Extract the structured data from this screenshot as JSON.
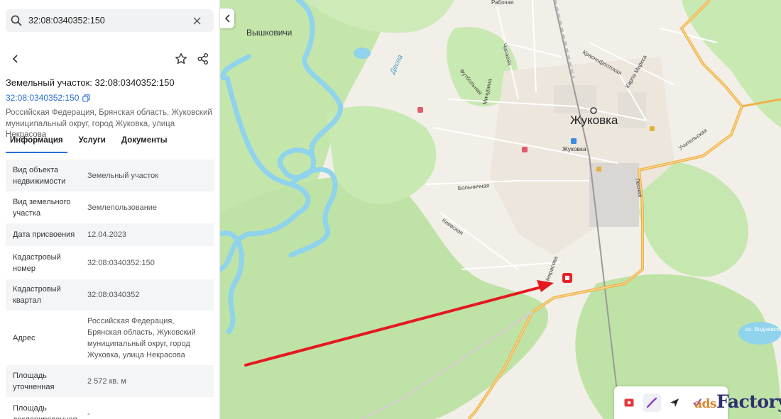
{
  "search": {
    "value": "32:08:0340352:150"
  },
  "card": {
    "title": "Земельный участок: 32:08:0340352:150",
    "cad_number_link": "32:08:0340352:150",
    "address": "Российская Федерация, Брянская область, Жуковский муниципальный округ, город Жуковка, улица Некрасова"
  },
  "tabs": [
    {
      "label": "Информация",
      "active": true
    },
    {
      "label": "Услуги"
    },
    {
      "label": "Документы"
    }
  ],
  "info_rows": [
    {
      "key": "Вид объекта недвижимости",
      "value": "Земельный участок"
    },
    {
      "key": "Вид земельного участка",
      "value": "Землепользование"
    },
    {
      "key": "Дата присвоения",
      "value": "12.04.2023"
    },
    {
      "key": "Кадастровый номер",
      "value": "32:08:0340352:150"
    },
    {
      "key": "Кадастровый квартал",
      "value": "32:08:0340352"
    },
    {
      "key": "Адрес",
      "value": "Российская Федерация, Брянская область, Жуковский муниципальный округ, город Жуковка, улица Некрасова"
    },
    {
      "key": "Площадь уточненная",
      "value": "2 572 кв. м"
    },
    {
      "key": "Площадь декларированная",
      "value": "-"
    }
  ],
  "map": {
    "labels": {
      "village": "Вышковичи",
      "city": "Жуковка",
      "station": "Жуковка",
      "river": "Десна",
      "lake": "оз. Водневское",
      "street_rabochaya": "Рабочая",
      "street_chapaeva": "Чапаева",
      "street_futbolnaya": "Футбольная",
      "street_minina": "Мичурина",
      "street_krasnoflot": "Краснофлотская",
      "street_karlamarksa": "Карла Маркса",
      "street_uchitel": "Учительская",
      "street_lesnaya": "Лесная",
      "street_bolnichnaya": "Больничная",
      "street_kievskaya": "Киевская",
      "street_nekrasova": "Некрасова"
    },
    "colors": {
      "forest": "#bfe3a6",
      "river": "#8fd3ec",
      "road": "#f0b24a",
      "marker": "#e8202a",
      "arrow": "#e3191f"
    }
  },
  "watermark": {
    "brand": "Factory",
    "prefix": "ads"
  }
}
